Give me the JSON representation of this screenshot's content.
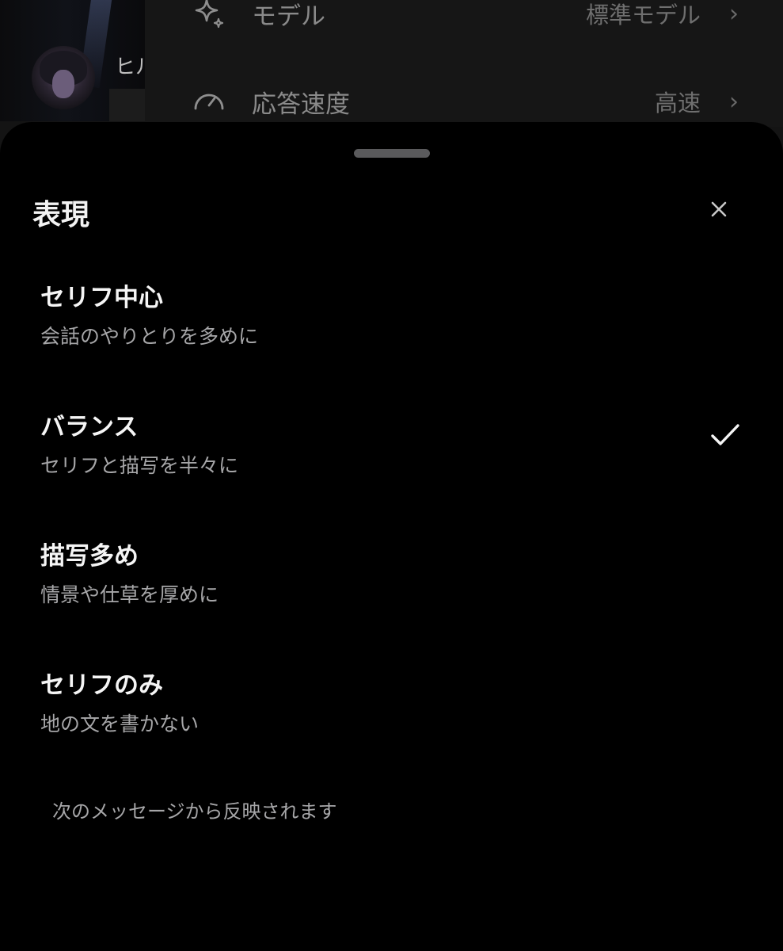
{
  "background": {
    "profile_name": "ヒル",
    "settings_rows": [
      {
        "icon": "sparkle-icon",
        "label": "モデル",
        "value": "標準モデル"
      },
      {
        "icon": "speedometer-icon",
        "label": "応答速度",
        "value": "高速"
      }
    ]
  },
  "sheet": {
    "title": "表現",
    "options": [
      {
        "label": "セリフ中心",
        "description": "会話のやりとりを多めに",
        "selected": false
      },
      {
        "label": "バランス",
        "description": "セリフと描写を半々に",
        "selected": true
      },
      {
        "label": "描写多め",
        "description": "情景や仕草を厚めに",
        "selected": false
      },
      {
        "label": "セリフのみ",
        "description": "地の文を書かない",
        "selected": false
      }
    ],
    "footer_note": "次のメッセージから反映されます"
  },
  "colors": {
    "sheet_background": "#000000",
    "primary_text": "#f5f5f5",
    "secondary_text": "#a6a6a8",
    "grabber": "#5a5a5c"
  }
}
